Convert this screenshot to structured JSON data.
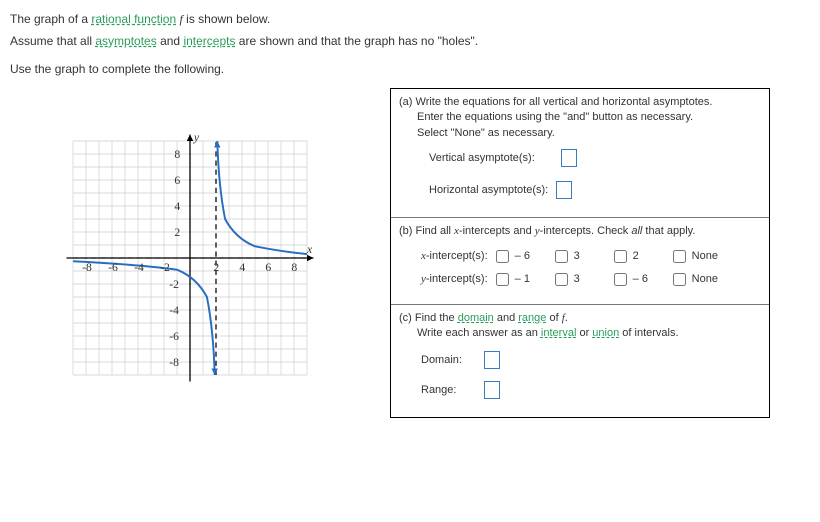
{
  "intro": {
    "line1_pre": "The graph of a ",
    "line1_link": "rational function",
    "line1_post": " f is shown below.",
    "line2_pre": "Assume that all ",
    "line2_link1": "asymptotes",
    "line2_mid": " and ",
    "line2_link2": "intercepts",
    "line2_post": " are shown and that the graph has no \"holes\".",
    "line3": "Use the graph to complete the following."
  },
  "part_a": {
    "label": "(a)",
    "text1": "Write the equations for all vertical and horizontal asymptotes.",
    "text2": "Enter the equations using the \"and\" button as necessary.",
    "text3": "Select \"None\" as necessary.",
    "vert_label": "Vertical asymptote(s):",
    "horiz_label": "Horizontal asymptote(s):"
  },
  "part_b": {
    "label": "(b)",
    "text": "Find all x-intercepts and y-intercepts. Check all that apply.",
    "x_label": "x-intercept(s):",
    "y_label": "y-intercept(s):",
    "x_options": [
      "– 6",
      "3",
      "2",
      "None"
    ],
    "y_options": [
      "– 1",
      "3",
      "– 6",
      "None"
    ]
  },
  "part_c": {
    "label": "(c)",
    "text_pre": "Find the ",
    "link1": "domain",
    "text_mid1": " and ",
    "link2": "range",
    "text_mid2": " of f.",
    "text2_pre": "Write each answer as an ",
    "link3": "interval",
    "text2_mid": " or ",
    "link4": "union",
    "text2_post": " of intervals.",
    "domain_label": "Domain:",
    "range_label": "Range:"
  },
  "chart_data": {
    "type": "line",
    "title": "",
    "xlabel": "x",
    "ylabel": "y",
    "x_ticks": [
      -8,
      -6,
      -4,
      -2,
      2,
      4,
      6,
      8
    ],
    "y_ticks": [
      -8,
      -6,
      -4,
      -2,
      2,
      4,
      6,
      8
    ],
    "xlim": [
      -9,
      9
    ],
    "ylim": [
      -9,
      9
    ],
    "vertical_asymptote": 2,
    "horizontal_asymptote": 0,
    "series": [
      {
        "name": "left-branch",
        "x": [
          -9,
          -8,
          -6,
          -4,
          -2,
          0,
          1,
          1.5,
          1.8,
          1.95
        ],
        "y": [
          -0.2,
          -0.25,
          -0.3,
          -0.4,
          -0.6,
          -1.2,
          -2.5,
          -5,
          -12,
          -40
        ]
      },
      {
        "name": "right-branch",
        "x": [
          2.05,
          2.2,
          2.5,
          3,
          4,
          6,
          8,
          9
        ],
        "y": [
          40,
          12,
          5,
          2.5,
          1.2,
          0.6,
          0.4,
          0.3
        ]
      }
    ]
  }
}
